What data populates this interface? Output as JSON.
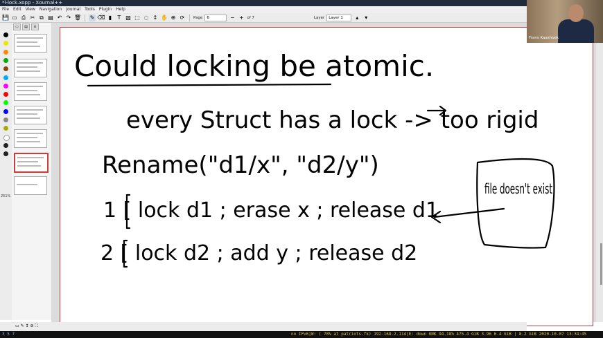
{
  "window": {
    "title": "*l-lock.xopp - Xournal++"
  },
  "menu": [
    "File",
    "Edit",
    "View",
    "Navigation",
    "Journal",
    "Tools",
    "Plugin",
    "Help"
  ],
  "toolbar": {
    "page_label": "Page",
    "page_value": "6",
    "page_of": "of 7",
    "layer_label": "Layer",
    "layer_value": "Layer 1"
  },
  "sidebar": {
    "zoom_label": "251%"
  },
  "palette_colors": [
    "#000000",
    "#e8e800",
    "#ff8800",
    "#00aa00",
    "#8b4513",
    "#00aaff",
    "#ff00ff",
    "#ff0000",
    "#00ff00",
    "#0000ff",
    "#888888",
    "#aaaa00",
    "#ffffff",
    "#222222",
    "#222222"
  ],
  "webcam": {
    "name": "Frans Kaashoek"
  },
  "statusbar": {
    "workspaces": "3 5 7",
    "text": "no IPv6|W: ( 70% at patriots-fk) 192.168.2.114|E: down UNK 94.18% 475.4 GiB 3.96 6.4 GiB | 8.2 GiB 2020-10-07 13:34:45"
  },
  "note": {
    "line1": "Could locking be atomic.",
    "line2": "every Struct has a lock -> too rigid",
    "line3": "Rename(\"d1/x\", \"d2/y\")",
    "line4": "1 [ lock d1 ; erase x ; release d1",
    "line5": "2 [ lock d2 ; add y ; release d2",
    "box": "file doesn't exist"
  }
}
